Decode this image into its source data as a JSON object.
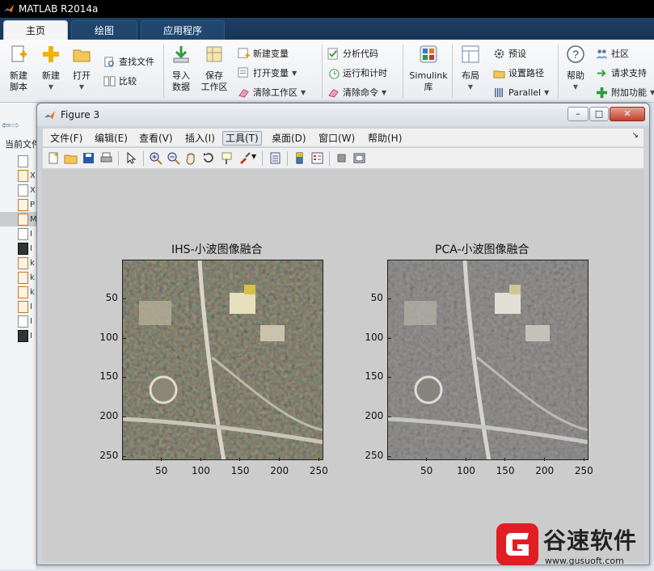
{
  "app": {
    "title": "MATLAB R2014a",
    "tabs": [
      "主页",
      "绘图",
      "应用程序"
    ]
  },
  "ribbon": {
    "new_script": "新建\n脚本",
    "new": "新建",
    "open": "打开",
    "find_files": "查找文件",
    "compare": "比较",
    "import_data": "导入\n数据",
    "save_workspace": "保存\n工作区",
    "new_variable": "新建变量",
    "open_variable": "打开变量",
    "clear_workspace": "清除工作区",
    "analyze_code": "分析代码",
    "run_and_time": "运行和计时",
    "clear_commands": "清除命令",
    "simulink": "Simulink\n库",
    "layout": "布局",
    "preferences": "预设",
    "set_path": "设置路径",
    "parallel": "Parallel",
    "help": "帮助",
    "community": "社区",
    "request_support": "请求支持",
    "add_ons": "附加功能"
  },
  "current_folder": {
    "label": "当前文件",
    "files": [
      {
        "type": "blank",
        "name": ""
      },
      {
        "type": "m",
        "name": "X"
      },
      {
        "type": "blank",
        "name": "X"
      },
      {
        "type": "m",
        "name": "P"
      },
      {
        "type": "m",
        "name": "M",
        "selected": true
      },
      {
        "type": "blank",
        "name": "I"
      },
      {
        "type": "jpg",
        "name": "I"
      },
      {
        "type": "m",
        "name": "k"
      },
      {
        "type": "m",
        "name": "k"
      },
      {
        "type": "m",
        "name": "k"
      },
      {
        "type": "m",
        "name": "I"
      },
      {
        "type": "blank",
        "name": "I"
      },
      {
        "type": "jpg",
        "name": "I"
      }
    ]
  },
  "figure": {
    "title": "Figure 3",
    "menu": [
      "文件(F)",
      "编辑(E)",
      "查看(V)",
      "插入(I)",
      "工具(T)",
      "桌面(D)",
      "窗口(W)",
      "帮助(H)"
    ],
    "active_menu": "工具(T)",
    "axes": [
      {
        "title": "IHS-小波图像融合",
        "xticks": [
          "50",
          "100",
          "150",
          "200",
          "250"
        ],
        "yticks": [
          "50",
          "100",
          "150",
          "200",
          "250"
        ],
        "color_mode": "color"
      },
      {
        "title": "PCA-小波图像融合",
        "xticks": [
          "50",
          "100",
          "150",
          "200",
          "250"
        ],
        "yticks": [
          "50",
          "100",
          "150",
          "200",
          "250"
        ],
        "color_mode": "grayscale"
      }
    ]
  },
  "watermark": {
    "brand": "谷速软件",
    "url": "www.gusuoft.com"
  },
  "colors": {
    "title_bar": "#000000",
    "tab_strip": "#1d3f63",
    "plot_background": "#cccccc"
  }
}
